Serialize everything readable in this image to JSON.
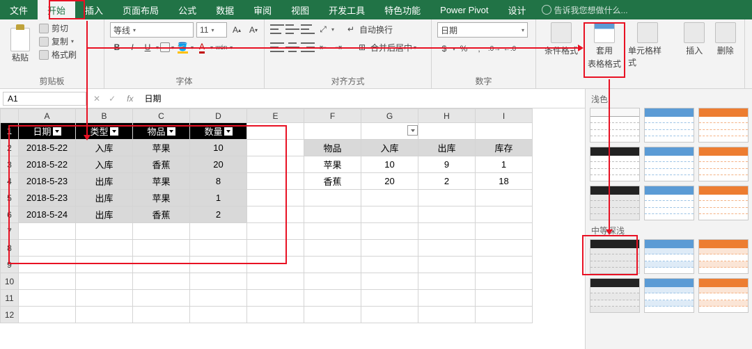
{
  "menu": {
    "tabs": [
      "文件",
      "开始",
      "插入",
      "页面布局",
      "公式",
      "数据",
      "审阅",
      "视图",
      "开发工具",
      "特色功能",
      "Power Pivot",
      "设计"
    ],
    "active": 1,
    "tell_me": "告诉我您想做什么..."
  },
  "ribbon": {
    "clipboard": {
      "title": "剪贴板",
      "paste": "粘贴",
      "cut": "剪切",
      "copy": "复制",
      "format_painter": "格式刷"
    },
    "font": {
      "title": "字体",
      "name": "等线",
      "size": "11",
      "bold": "B",
      "italic": "I",
      "underline": "U",
      "wen": "wén"
    },
    "alignment": {
      "title": "对齐方式",
      "wrap": "自动换行",
      "merge": "合并后居中"
    },
    "number": {
      "title": "数字",
      "format": "日期"
    },
    "styles": {
      "conditional": "条件格式",
      "table_format": "套用",
      "table_format2": "表格格式",
      "cell_styles": "单元格样式"
    },
    "cells": {
      "insert": "插入",
      "delete": "删除"
    }
  },
  "gallery": {
    "light": "浅色",
    "medium": "中等深浅"
  },
  "namebox": {
    "ref": "A1",
    "formula_value": "日期"
  },
  "sheet": {
    "cols": [
      "A",
      "B",
      "C",
      "D",
      "E",
      "F",
      "G",
      "H",
      "I"
    ],
    "table": {
      "headers": [
        "日期",
        "类型",
        "物品",
        "数量"
      ],
      "rows": [
        [
          "2018-5-22",
          "入库",
          "苹果",
          "10"
        ],
        [
          "2018-5-22",
          "入库",
          "香蕉",
          "20"
        ],
        [
          "2018-5-23",
          "出库",
          "苹果",
          "8"
        ],
        [
          "2018-5-23",
          "出库",
          "苹果",
          "1"
        ],
        [
          "2018-5-24",
          "出库",
          "香蕉",
          "2"
        ]
      ]
    },
    "summary": {
      "headers": [
        "物品",
        "入库",
        "出库",
        "库存"
      ],
      "rows": [
        [
          "苹果",
          "10",
          "9",
          "1"
        ],
        [
          "香蕉",
          "20",
          "2",
          "18"
        ]
      ]
    }
  }
}
